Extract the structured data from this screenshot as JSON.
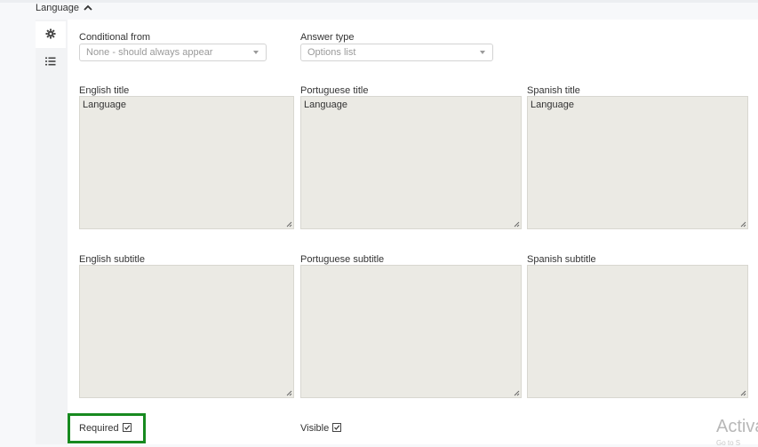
{
  "section": {
    "title": "Language",
    "toggle_icon": "chevron-up-icon"
  },
  "side_tabs": [
    {
      "icon": "gear-icon",
      "active": true
    },
    {
      "icon": "list-icon",
      "active": false
    }
  ],
  "conditional": {
    "label": "Conditional from",
    "value": "None - should always appear"
  },
  "answer_type": {
    "label": "Answer type",
    "value": "Options list"
  },
  "titles": {
    "english": {
      "label": "English title",
      "value": "Language"
    },
    "portuguese": {
      "label": "Portuguese title",
      "value": "Language"
    },
    "spanish": {
      "label": "Spanish title",
      "value": "Language"
    }
  },
  "subtitles": {
    "english": {
      "label": "English subtitle",
      "value": ""
    },
    "portuguese": {
      "label": "Portuguese subtitle",
      "value": ""
    },
    "spanish": {
      "label": "Spanish subtitle",
      "value": ""
    }
  },
  "required": {
    "label": "Required",
    "checked": true
  },
  "visible": {
    "label": "Visible",
    "checked": true
  },
  "watermark": {
    "text": "Activa",
    "subtext": "Go to S"
  },
  "colors": {
    "textarea_bg": "#ebeae4",
    "highlight": "#178a1f"
  }
}
